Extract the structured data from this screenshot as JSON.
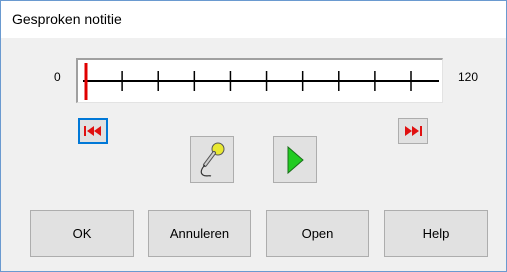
{
  "window": {
    "title": "Gesproken notitie"
  },
  "timeline": {
    "min_label": "0",
    "max_label": "120",
    "position": 0,
    "tick_count": 10,
    "marker_color": "#e00000"
  },
  "transport": {
    "rewind_icon": "skip-to-start-icon",
    "fast_forward_icon": "skip-to-end-icon",
    "record_icon": "microphone-icon",
    "play_icon": "play-icon",
    "accent_red": "#e01010",
    "play_green": "#22cc22"
  },
  "buttons": {
    "ok": "OK",
    "cancel": "Annuleren",
    "open": "Open",
    "help": "Help"
  }
}
